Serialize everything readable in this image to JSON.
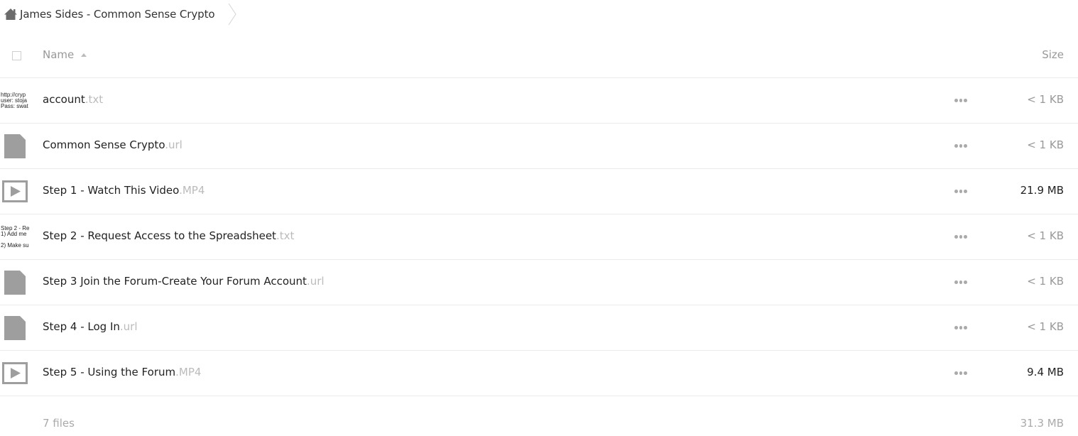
{
  "breadcrumb": {
    "home_icon": "home-icon",
    "current_folder": "James Sides - Common Sense Crypto",
    "separator_icon": "chevron-right-icon"
  },
  "table": {
    "columns": {
      "name": "Name",
      "size": "Size",
      "sort_direction": "ascending"
    },
    "files": [
      {
        "basename": "account",
        "extension": ".txt",
        "size": "< 1 KB",
        "thumbnail": "text-preview",
        "preview_lines": [
          "http://cryp",
          "user: stoja",
          "Pass: swat"
        ]
      },
      {
        "basename": "Common Sense Crypto",
        "extension": ".url",
        "size": "< 1 KB",
        "thumbnail": "file-icon"
      },
      {
        "basename": "Step 1 - Watch This Video",
        "extension": ".MP4",
        "size": "21.9 MB",
        "thumbnail": "video-icon"
      },
      {
        "basename": "Step 2 - Request Access to the Spreadsheet",
        "extension": ".txt",
        "size": "< 1 KB",
        "thumbnail": "text-preview",
        "preview_lines": [
          "Step 2 - Re",
          "1) Add me",
          "",
          "2) Make su"
        ]
      },
      {
        "basename": "Step 3 Join the Forum-Create Your Forum Account",
        "extension": ".url",
        "size": "< 1 KB",
        "thumbnail": "file-icon"
      },
      {
        "basename": "Step 4 - Log In",
        "extension": ".url",
        "size": "< 1 KB",
        "thumbnail": "file-icon"
      },
      {
        "basename": "Step 5 - Using the Forum",
        "extension": ".MP4",
        "size": "9.4 MB",
        "thumbnail": "video-icon"
      }
    ]
  },
  "summary": {
    "count": "7 files",
    "total_size": "31.3 MB"
  },
  "colors": {
    "text": "#222222",
    "muted": "#999999",
    "extension": "#bbbbbb",
    "icon_gray": "#9e9e9e",
    "divider": "#ebebeb"
  }
}
